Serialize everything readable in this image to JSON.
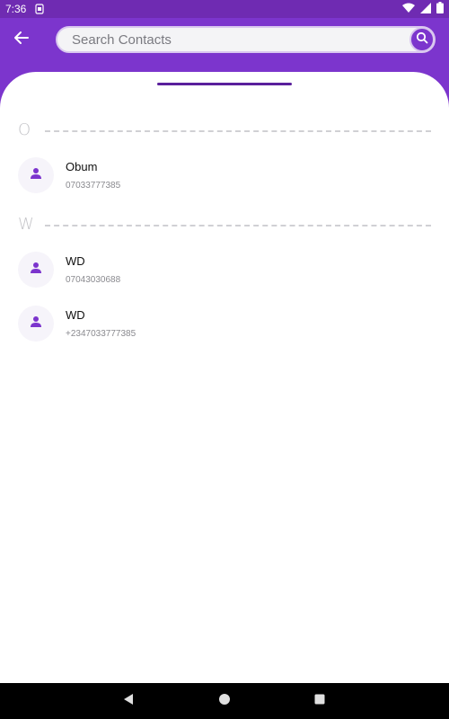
{
  "status_bar": {
    "time": "7:36",
    "icons": [
      "sim-icon",
      "wifi-icon",
      "signal-icon",
      "battery-icon"
    ]
  },
  "header": {
    "back_icon": "arrow-left-icon",
    "search": {
      "placeholder": "Search Contacts",
      "value": ""
    },
    "search_icon": "search-icon"
  },
  "colors": {
    "primary": "#7c35cd",
    "status_bar": "#6f2bb2",
    "handle": "#5a1f9c",
    "avatar_icon": "#7c35cd"
  },
  "sections": [
    {
      "letter": "O",
      "contacts": [
        {
          "name": "Obum",
          "phone": "07033777385",
          "icon": "person-icon"
        }
      ]
    },
    {
      "letter": "W",
      "contacts": [
        {
          "name": "WD",
          "phone": "07043030688",
          "icon": "person-icon"
        },
        {
          "name": "WD",
          "phone": "+2347033777385",
          "icon": "person-icon"
        }
      ]
    }
  ],
  "nav_bar": {
    "icons": [
      "back-triangle-icon",
      "home-circle-icon",
      "recents-square-icon"
    ]
  }
}
